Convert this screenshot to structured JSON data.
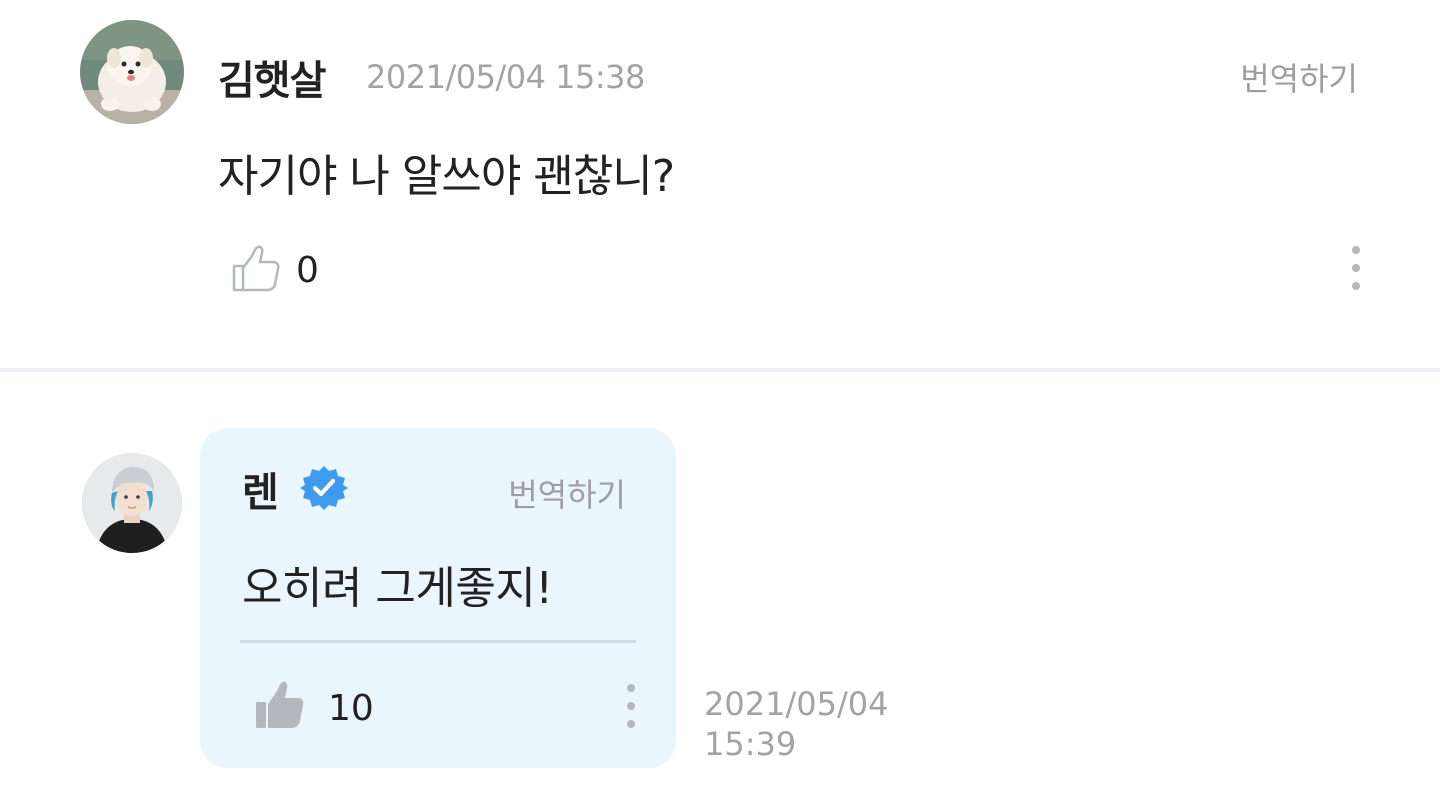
{
  "comment": {
    "author": "김햇살",
    "timestamp": "2021/05/04 15:38",
    "translate_label": "번역하기",
    "body": "자기야 나 알쓰야 괜찮니?",
    "like_count": "0",
    "icons": {
      "like": "thumbs-up-outline-icon",
      "more": "more-vertical-icon"
    }
  },
  "reply": {
    "author": "렌",
    "verified": true,
    "translate_label": "번역하기",
    "body": "오히려 그게좋지!",
    "like_count": "10",
    "timestamp_date": "2021/05/04",
    "timestamp_time": "15:39",
    "icons": {
      "like": "thumbs-up-filled-icon",
      "more": "more-vertical-icon",
      "badge": "verified-badge-icon"
    }
  },
  "colors": {
    "reply_bubble_bg": "#e9f6fe",
    "verified_blue": "#3d9bf0",
    "muted_text": "#a3a3a3",
    "icon_gray": "#b4b7bb"
  }
}
